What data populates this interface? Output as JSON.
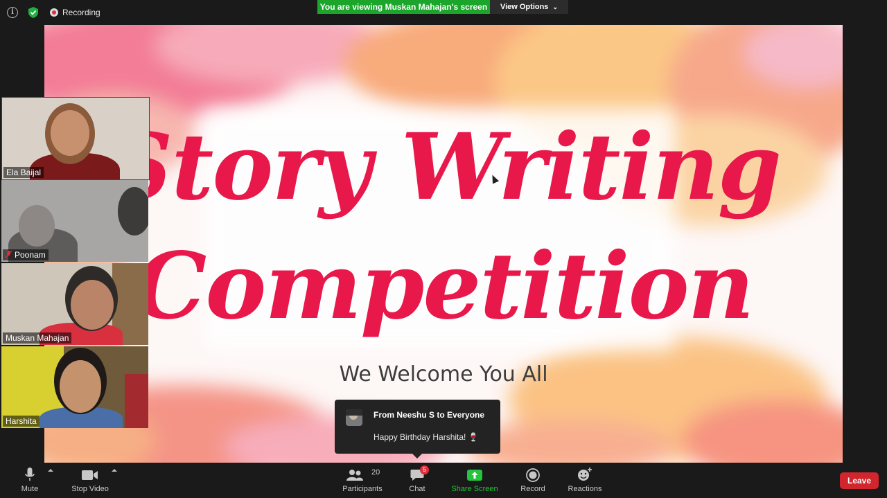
{
  "top_bar": {
    "recording_label": "Recording",
    "viewing_banner": "You are viewing Muskan Mahajan's screen",
    "view_options_label": "View Options"
  },
  "slide": {
    "title_line1": "Story Writing",
    "title_line2": "Competition",
    "welcome": "We Welcome You All"
  },
  "participants": [
    {
      "name": "Ela Baijal",
      "muted": false
    },
    {
      "name": "Poonam",
      "muted": true
    },
    {
      "name": "Muskan Mahajan",
      "muted": false
    },
    {
      "name": "Harshita",
      "muted": false
    }
  ],
  "chat_toast": {
    "from": "From Neeshu S to Everyone",
    "message": "Happy Birthday Harshita! 🍷"
  },
  "toolbar": {
    "mute_label": "Mute",
    "stop_video_label": "Stop Video",
    "participants_label": "Participants",
    "participants_count": "20",
    "chat_label": "Chat",
    "chat_badge": "5",
    "share_label": "Share Screen",
    "record_label": "Record",
    "reactions_label": "Reactions",
    "leave_label": "Leave"
  },
  "colors": {
    "banner_green": "#1ba52b",
    "title_pink": "#e8184a",
    "leave_red": "#d1262e",
    "share_green": "#24c43c"
  }
}
